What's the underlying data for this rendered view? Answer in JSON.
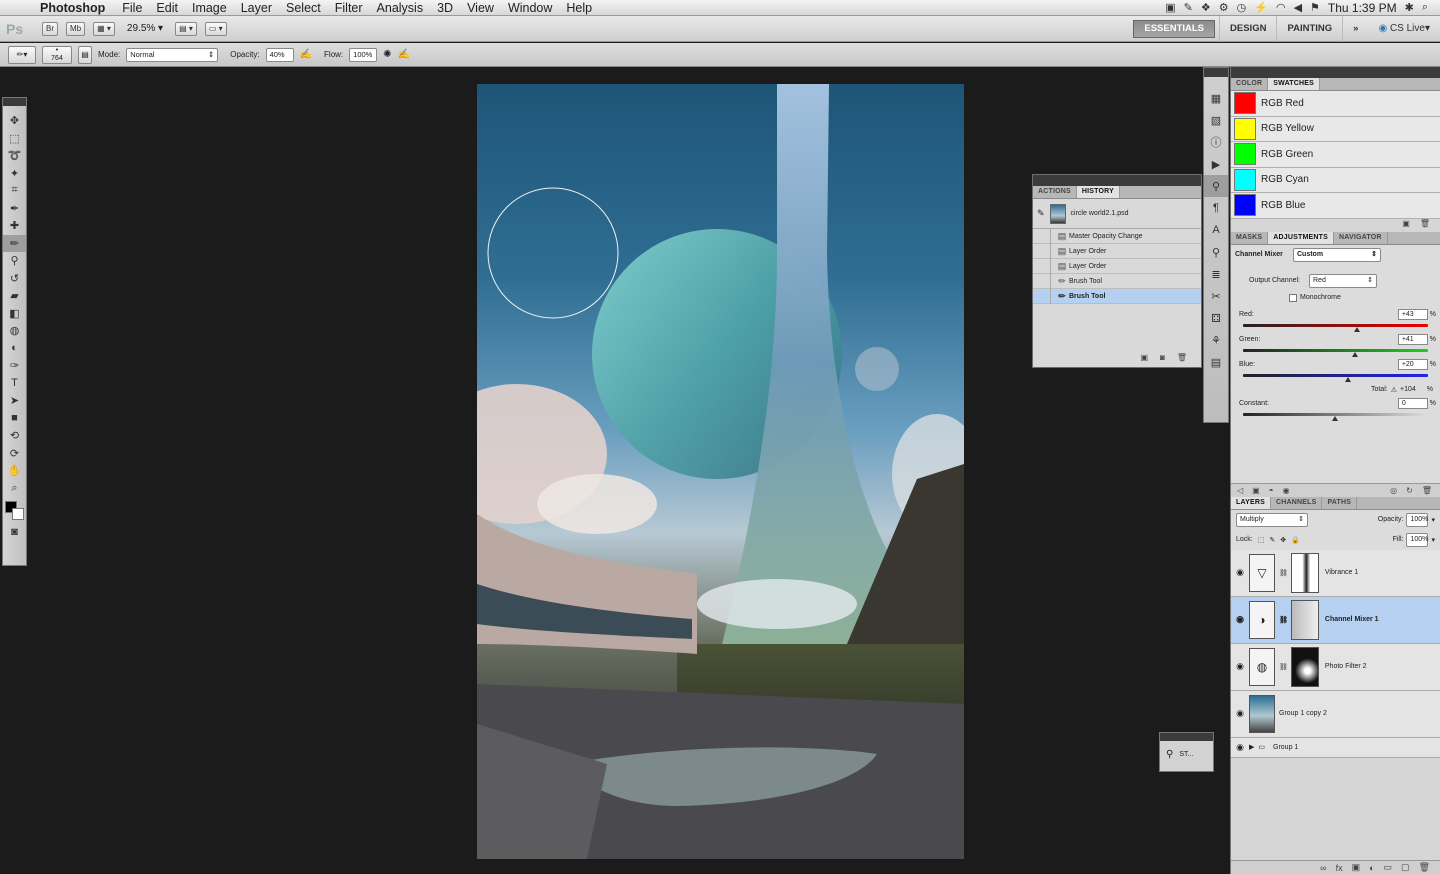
{
  "menubar": {
    "app": "Photoshop",
    "items": [
      "File",
      "Edit",
      "Image",
      "Layer",
      "Select",
      "Filter",
      "Analysis",
      "3D",
      "View",
      "Window",
      "Help"
    ],
    "clock": "Thu 1:39 PM"
  },
  "appbar": {
    "logo": "Ps",
    "br": "Br",
    "mb": "Mb",
    "zoom": "29.5%",
    "workspaces": [
      "ESSENTIALS",
      "DESIGN",
      "PAINTING"
    ],
    "more": "»",
    "cslive": "CS Live"
  },
  "options": {
    "brush_size": "764",
    "mode_label": "Mode:",
    "mode_value": "Normal",
    "opacity_label": "Opacity:",
    "opacity_value": "40%",
    "flow_label": "Flow:",
    "flow_value": "100%"
  },
  "history": {
    "tabs": [
      "ACTIONS",
      "HISTORY"
    ],
    "source": "circle world2.1.psd",
    "items": [
      "Master Opacity Change",
      "Layer Order",
      "Layer Order",
      "Brush Tool",
      "Brush Tool"
    ]
  },
  "swatches": {
    "tabs": [
      "COLOR",
      "SWATCHES"
    ],
    "items": [
      {
        "label": "RGB Red",
        "color": "#ff0000"
      },
      {
        "label": "RGB Yellow",
        "color": "#ffff00"
      },
      {
        "label": "RGB Green",
        "color": "#00ff00"
      },
      {
        "label": "RGB Cyan",
        "color": "#00ffff"
      },
      {
        "label": "RGB Blue",
        "color": "#0000ff"
      }
    ]
  },
  "adjustments": {
    "tabs": [
      "MASKS",
      "ADJUSTMENTS",
      "NAVIGATOR"
    ],
    "title": "Channel Mixer",
    "preset": "Custom",
    "output_label": "Output Channel:",
    "output_value": "Red",
    "monochrome": "Monochrome",
    "red_label": "Red:",
    "red_value": "+43",
    "green_label": "Green:",
    "green_value": "+41",
    "blue_label": "Blue:",
    "blue_value": "+20",
    "total_label": "Total:",
    "total_value": "+104",
    "constant_label": "Constant:",
    "constant_value": "0",
    "pct": "%"
  },
  "layers": {
    "tabs": [
      "LAYERS",
      "CHANNELS",
      "PATHS"
    ],
    "blend": "Multiply",
    "opacity_label": "Opacity:",
    "opacity_value": "100%",
    "lock_label": "Lock:",
    "fill_label": "Fill:",
    "fill_value": "100%",
    "items": [
      "Vibrance 1",
      "Channel Mixer 1",
      "Photo Filter 2",
      "Group 1 copy 2",
      "Group 1"
    ]
  },
  "mini": {
    "label": "ST..."
  }
}
